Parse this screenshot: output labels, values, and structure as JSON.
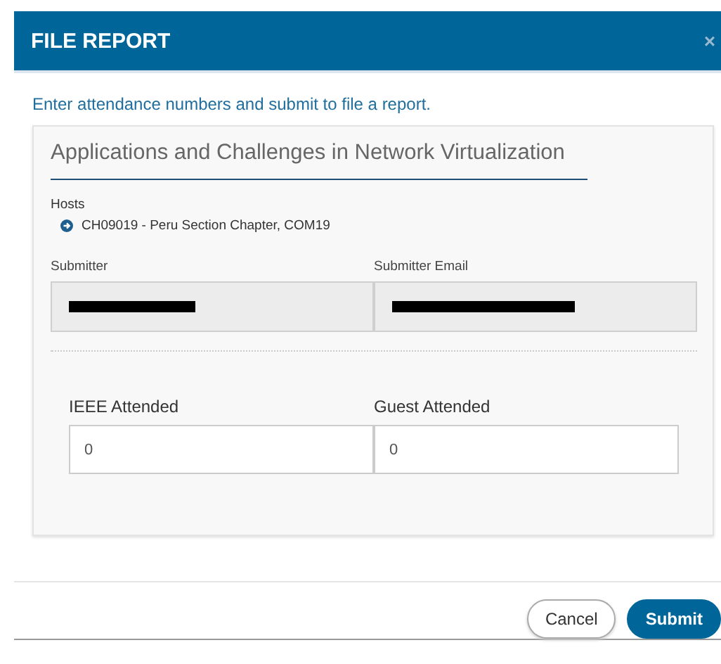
{
  "dialog": {
    "title": "FILE REPORT",
    "close": "×"
  },
  "intro": "Enter attendance numbers and submit to file a report.",
  "event": {
    "title": "Applications and Challenges in Network Virtualization"
  },
  "hosts": {
    "label": "Hosts",
    "items": [
      "CH09019 - Peru Section Chapter, COM19"
    ]
  },
  "submitter_fields": [
    {
      "label": "Submitter",
      "redacted": true
    },
    {
      "label": "Submitter Email",
      "redacted": true
    }
  ],
  "attendance_fields": [
    {
      "label": "IEEE Attended",
      "value": "0"
    },
    {
      "label": "Guest Attended",
      "value": "0"
    }
  ],
  "buttons": [
    {
      "label": "Cancel",
      "kind": "secondary"
    },
    {
      "label": "Submit",
      "kind": "primary"
    }
  ]
}
